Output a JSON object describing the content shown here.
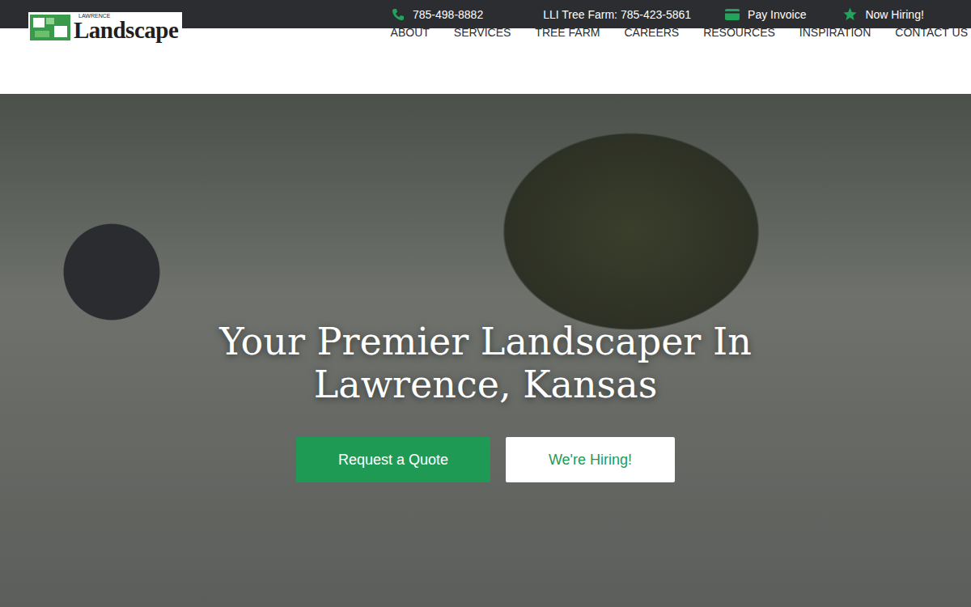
{
  "logo": {
    "small": "LAWRENCE",
    "main": "Landscape"
  },
  "top_bar": {
    "phone": "785-498-8882",
    "tree_farm": "LLI Tree Farm: 785-423-5861",
    "invoice": "Pay Invoice",
    "hiring": "Now Hiring!"
  },
  "nav": {
    "items": [
      "ABOUT",
      "SERVICES",
      "TREE FARM",
      "CAREERS",
      "RESOURCES",
      "INSPIRATION",
      "CONTACT US"
    ]
  },
  "hero": {
    "title": "Your Premier Landscaper In Lawrence, Kansas",
    "primary_button": "Request a Quote",
    "secondary_button": "We're Hiring!"
  }
}
